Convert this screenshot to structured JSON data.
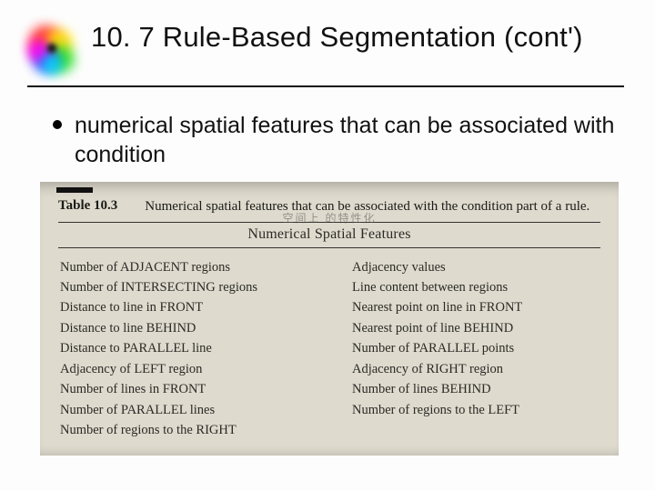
{
  "title": "10. 7 Rule-Based Segmentation (cont')",
  "bullet": "numerical spatial features that can be associated with condition",
  "table": {
    "label": "Table 10.3",
    "caption": "Numerical spatial features that can be associated with the condition part of a rule.",
    "section_heading": "Numerical Spatial Features",
    "annotation": "空间上 的特性化",
    "left": [
      "Number of ADJACENT regions",
      "Number of INTERSECTING regions",
      "Distance to line in FRONT",
      "Distance to line BEHIND",
      "Distance to PARALLEL line",
      "Adjacency of LEFT region",
      "Number of lines in FRONT",
      "Number of PARALLEL lines",
      "Number of regions to the RIGHT"
    ],
    "right": [
      "Adjacency values",
      "Line content between regions",
      "Nearest point on line in FRONT",
      "Nearest point of line BEHIND",
      "Number of PARALLEL points",
      "Adjacency of RIGHT region",
      "Number of lines BEHIND",
      "Number of regions to the LEFT"
    ]
  }
}
